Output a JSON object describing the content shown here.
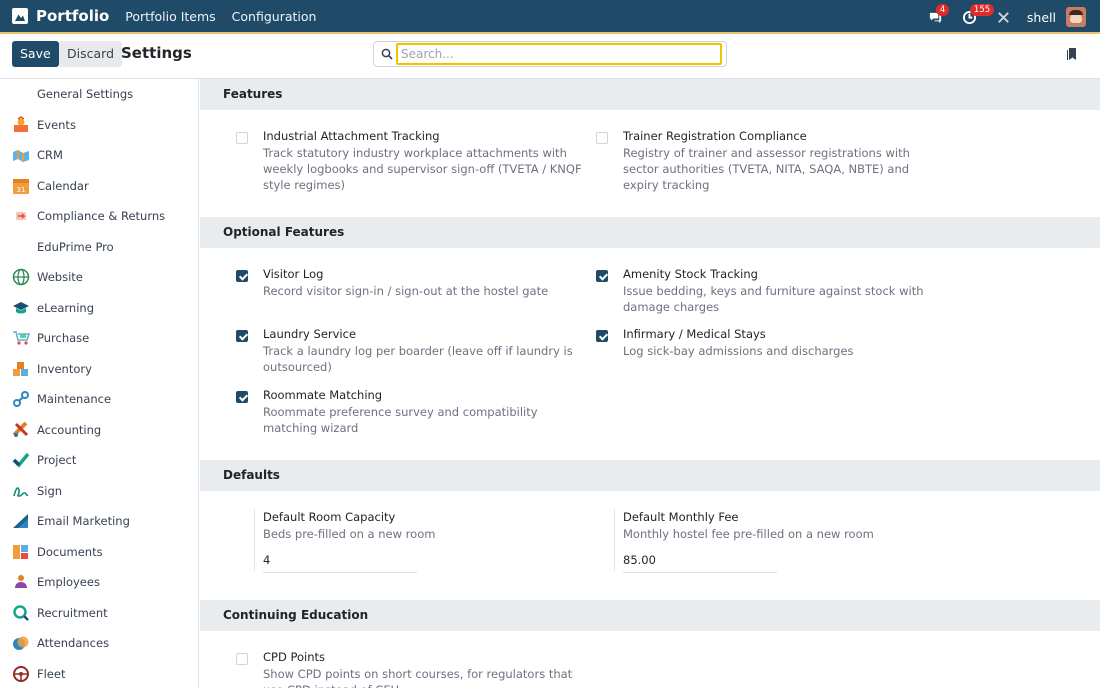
{
  "navbar": {
    "app_name": "Portfolio",
    "menu": [
      "Portfolio Items",
      "Configuration"
    ],
    "messages_count": "4",
    "activities_count": "155",
    "user": "shell"
  },
  "control": {
    "save_label": "Save",
    "discard_label": "Discard",
    "title": "Settings",
    "search_placeholder": "Search..."
  },
  "sidebar": {
    "items": [
      {
        "label": "General Settings",
        "icon": "none"
      },
      {
        "label": "Events",
        "icon": "events-icon"
      },
      {
        "label": "CRM",
        "icon": "crm-icon"
      },
      {
        "label": "Calendar",
        "icon": "calendar-icon",
        "icon_text": "31"
      },
      {
        "label": "Compliance & Returns",
        "icon": "compliance-icon"
      },
      {
        "label": "EduPrime Pro",
        "icon": "none"
      },
      {
        "label": "Website",
        "icon": "website-icon"
      },
      {
        "label": "eLearning",
        "icon": "elearning-icon"
      },
      {
        "label": "Purchase",
        "icon": "purchase-icon"
      },
      {
        "label": "Inventory",
        "icon": "inventory-icon"
      },
      {
        "label": "Maintenance",
        "icon": "maintenance-icon"
      },
      {
        "label": "Accounting",
        "icon": "accounting-icon"
      },
      {
        "label": "Project",
        "icon": "project-icon"
      },
      {
        "label": "Sign",
        "icon": "sign-icon"
      },
      {
        "label": "Email Marketing",
        "icon": "email-marketing-icon"
      },
      {
        "label": "Documents",
        "icon": "documents-icon"
      },
      {
        "label": "Employees",
        "icon": "employees-icon"
      },
      {
        "label": "Recruitment",
        "icon": "recruitment-icon"
      },
      {
        "label": "Attendances",
        "icon": "attendances-icon"
      },
      {
        "label": "Fleet",
        "icon": "fleet-icon"
      }
    ]
  },
  "sections": {
    "features": {
      "title": "Features",
      "items": [
        {
          "title": "Industrial Attachment Tracking",
          "desc": "Track statutory industry workplace attachments with weekly logbooks and supervisor sign-off (TVETA / KNQF style regimes)",
          "checked": false
        },
        {
          "title": "Trainer Registration Compliance",
          "desc": "Registry of trainer and assessor registrations with sector authorities (TVETA, NITA, SAQA, NBTE) and expiry tracking",
          "checked": false
        }
      ]
    },
    "optional": {
      "title": "Optional Features",
      "items": [
        {
          "title": "Visitor Log",
          "desc": "Record visitor sign-in / sign-out at the hostel gate",
          "checked": true
        },
        {
          "title": "Amenity Stock Tracking",
          "desc": "Issue bedding, keys and furniture against stock with damage charges",
          "checked": true
        },
        {
          "title": "Laundry Service",
          "desc": "Track a laundry log per boarder (leave off if laundry is outsourced)",
          "checked": true
        },
        {
          "title": "Infirmary / Medical Stays",
          "desc": "Log sick-bay admissions and discharges",
          "checked": true
        },
        {
          "title": "Roommate Matching",
          "desc": "Roommate preference survey and compatibility matching wizard",
          "checked": true
        }
      ]
    },
    "defaults": {
      "title": "Defaults",
      "items": [
        {
          "title": "Default Room Capacity",
          "desc": "Beds pre-filled on a new room",
          "value": "4"
        },
        {
          "title": "Default Monthly Fee",
          "desc": "Monthly hostel fee pre-filled on a new room",
          "value": "85.00"
        }
      ]
    },
    "cpd": {
      "title": "Continuing Education",
      "items": [
        {
          "title": "CPD Points",
          "desc": "Show CPD points on short courses, for regulators that use CPD instead of CEU",
          "checked": false
        }
      ]
    }
  }
}
